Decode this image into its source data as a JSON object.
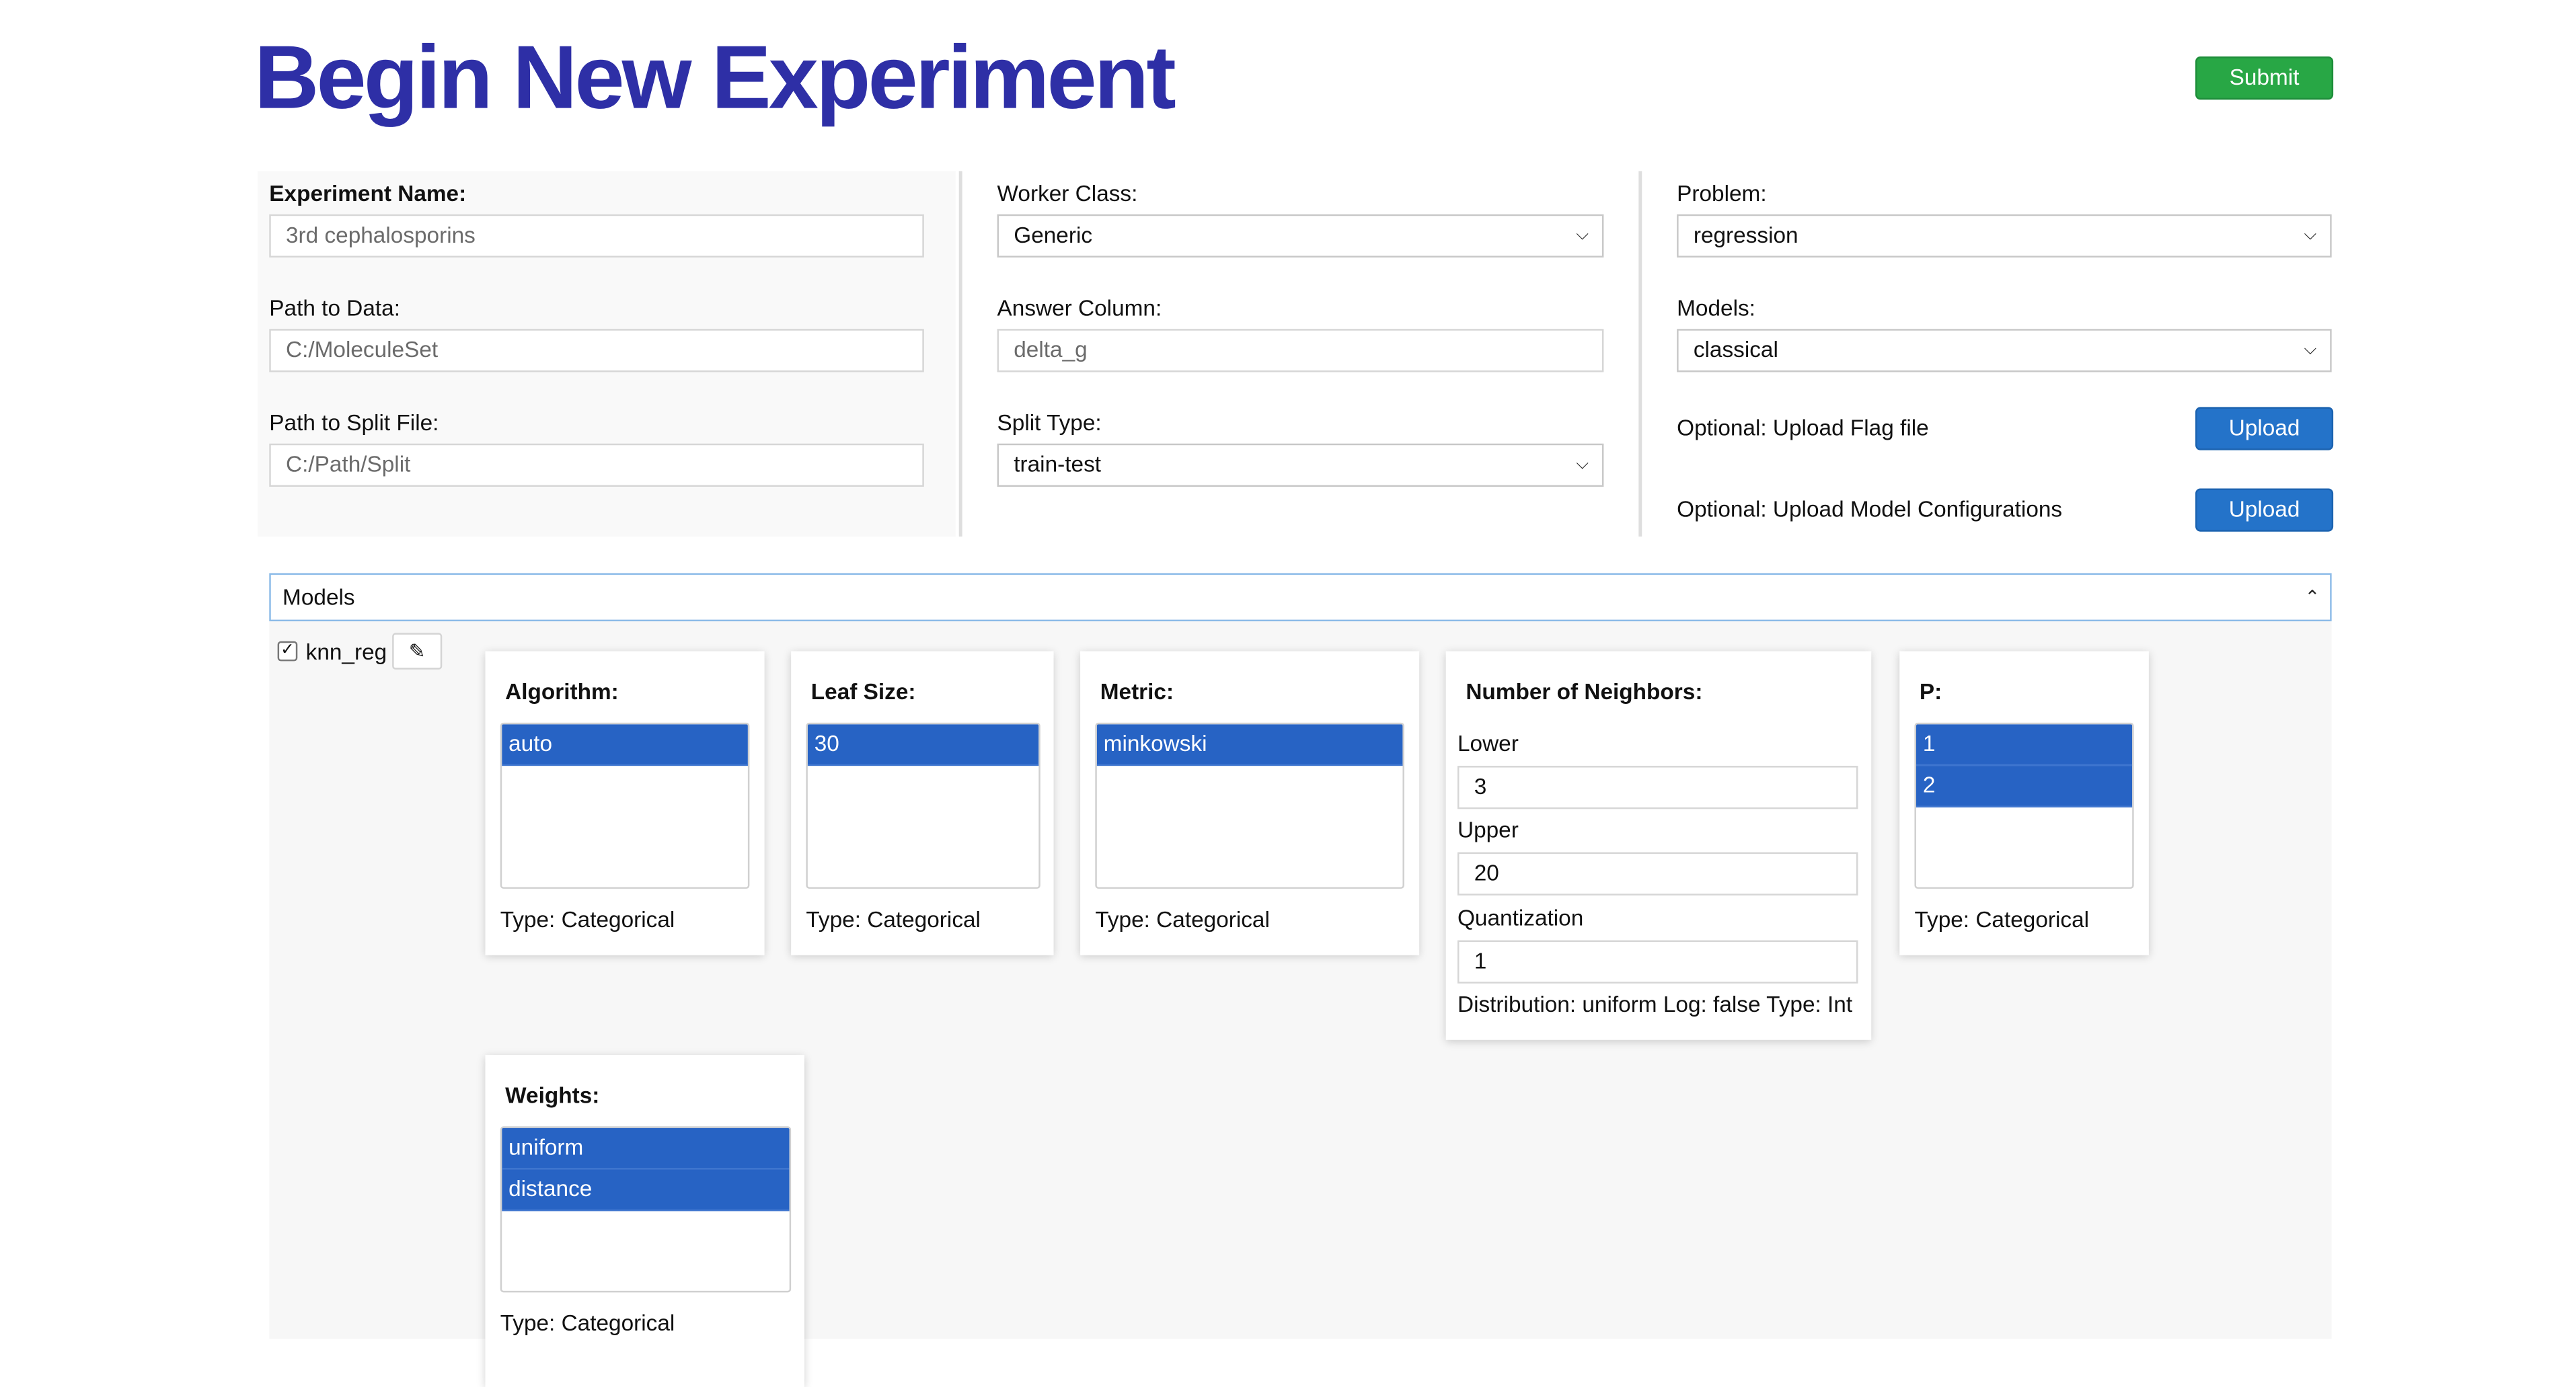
{
  "header": {
    "title": "Begin New Experiment",
    "submit_label": "Submit"
  },
  "form": {
    "experiment_name": {
      "label": "Experiment Name:",
      "placeholder": "3rd cephalosporins"
    },
    "path_to_data": {
      "label": "Path to Data:",
      "placeholder": "C:/MoleculeSet"
    },
    "path_to_split": {
      "label": "Path to Split File:",
      "placeholder": "C:/Path/Split"
    },
    "worker_class": {
      "label": "Worker Class:",
      "value": "Generic"
    },
    "answer_column": {
      "label": "Answer Column:",
      "placeholder": "delta_g"
    },
    "split_type": {
      "label": "Split Type:",
      "value": "train-test"
    },
    "problem": {
      "label": "Problem:",
      "value": "regression"
    },
    "models": {
      "label": "Models:",
      "value": "classical"
    },
    "upload_flag": {
      "label": "Optional: Upload Flag file",
      "button": "Upload"
    },
    "upload_config": {
      "label": "Optional: Upload Model Configurations",
      "button": "Upload"
    }
  },
  "models_panel": {
    "header_label": "Models",
    "model": {
      "name": "knn_reg",
      "checked": true
    },
    "params": {
      "algorithm": {
        "title": "Algorithm:",
        "options": [
          "auto"
        ],
        "type": "Type: Categorical"
      },
      "leaf_size": {
        "title": "Leaf Size:",
        "options": [
          "30"
        ],
        "type": "Type: Categorical"
      },
      "metric": {
        "title": "Metric:",
        "options": [
          "minkowski"
        ],
        "type": "Type: Categorical"
      },
      "neighbors": {
        "title": "Number of Neighbors:",
        "lower_label": "Lower",
        "lower_value": "3",
        "upper_label": "Upper",
        "upper_value": "20",
        "quant_label": "Quantization",
        "quant_value": "1",
        "info": "Distribution: uniform Log: false Type: Int"
      },
      "p": {
        "title": "P:",
        "options": [
          "1",
          "2"
        ],
        "type": "Type: Categorical"
      },
      "weights": {
        "title": "Weights:",
        "options": [
          "uniform",
          "distance"
        ],
        "type": "Type: Categorical"
      }
    }
  },
  "colors": {
    "title": "#2e2fa6",
    "submit": "#28a745",
    "upload": "#2473c9",
    "selected_option": "#2763c4"
  },
  "icons": {
    "chevron": "chevron-down-icon",
    "collapse": "chevron-up-icon",
    "edit": "pencil-icon",
    "check": "check-icon"
  }
}
